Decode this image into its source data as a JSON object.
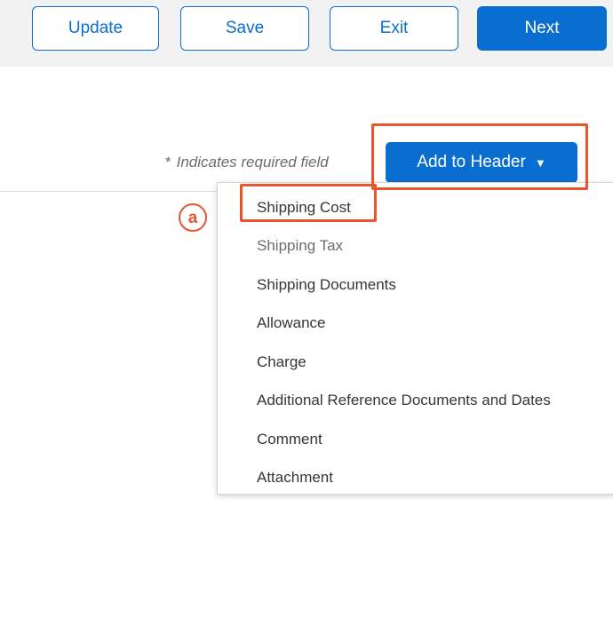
{
  "toolbar": {
    "update_label": "Update",
    "save_label": "Save",
    "exit_label": "Exit",
    "next_label": "Next"
  },
  "form": {
    "required_star": "*",
    "required_note": "Indicates required field",
    "add_to_header_label": "Add to Header",
    "add_to_header_caret": "▼"
  },
  "menu": {
    "items": [
      {
        "label": "Shipping Cost"
      },
      {
        "label": "Shipping Tax"
      },
      {
        "label": "Shipping Documents"
      },
      {
        "label": "Allowance"
      },
      {
        "label": "Charge"
      },
      {
        "label": "Additional Reference Documents and Dates"
      },
      {
        "label": "Comment"
      },
      {
        "label": "Attachment"
      }
    ]
  },
  "annotation": {
    "callout_label": "a"
  },
  "colors": {
    "primary": "#0a6ed1",
    "highlight": "#e8562e",
    "toolbar_bg": "#f2f2f2"
  }
}
